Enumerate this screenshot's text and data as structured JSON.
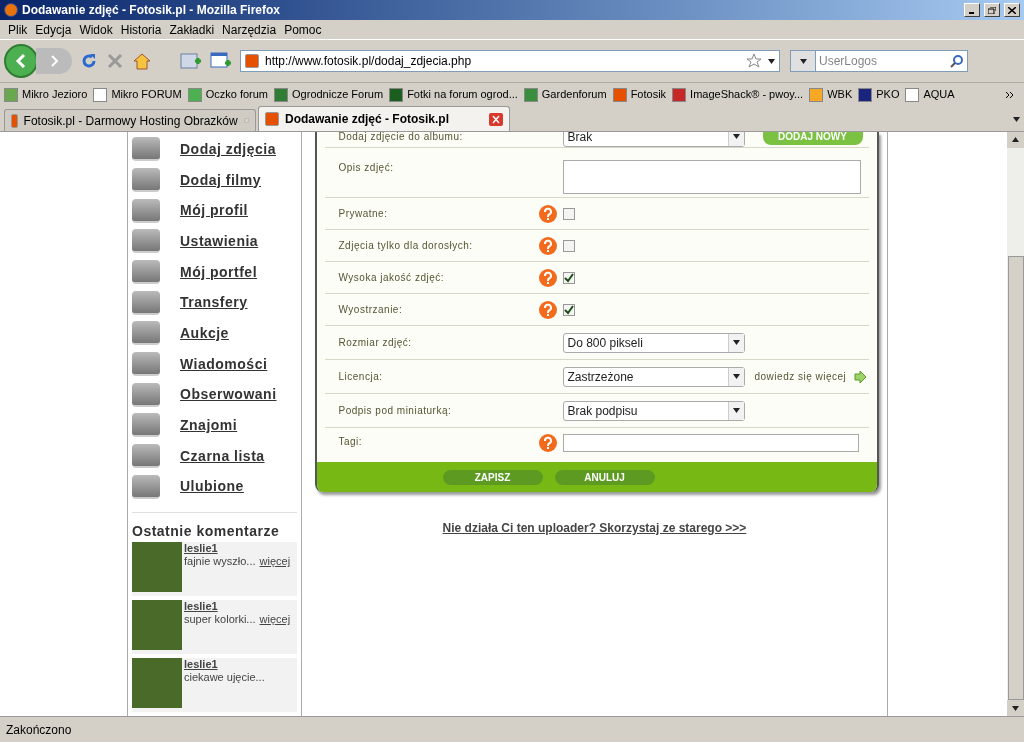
{
  "window": {
    "title": "Dodawanie zdjęć - Fotosik.pl - Mozilla Firefox"
  },
  "menu": [
    "Plik",
    "Edycja",
    "Widok",
    "Historia",
    "Zakładki",
    "Narzędzia",
    "Pomoc"
  ],
  "address": {
    "value": "http://www.fotosik.pl/dodaj_zdjecia.php"
  },
  "search": {
    "placeholder": "UserLogos"
  },
  "bookmarks": [
    {
      "label": "Mikro Jezioro",
      "color": "#6aa84f"
    },
    {
      "label": "Mikro FORUM",
      "color": "#ffffff"
    },
    {
      "label": "Oczko forum",
      "color": "#4caf50"
    },
    {
      "label": "Ogrodnicze  Forum",
      "color": "#2e7d32"
    },
    {
      "label": "Fotki na forum ogrod...",
      "color": "#1b5e20"
    },
    {
      "label": "Gardenforum",
      "color": "#388e3c"
    },
    {
      "label": "Fotosik",
      "color": "#e65100"
    },
    {
      "label": "ImageShack® - pwoy...",
      "color": "#c62828"
    },
    {
      "label": "WBK",
      "color": "#f9a825"
    },
    {
      "label": "PKO",
      "color": "#1a237e"
    },
    {
      "label": "AQUA",
      "color": "#ffffff"
    }
  ],
  "tabs": [
    {
      "label": "Fotosik.pl - Darmowy Hosting Obrazków",
      "selected": false
    },
    {
      "label": "Dodawanie zdjęć - Fotosik.pl",
      "selected": true
    }
  ],
  "sidebar": {
    "items": [
      "Dodaj zdjęcia",
      "Dodaj filmy",
      "Mój profil",
      "Ustawienia",
      "Mój portfel",
      "Transfery",
      "Aukcje",
      "Wiadomości",
      "Obserwowani",
      "Znajomi",
      "Czarna lista",
      "Ulubione"
    ],
    "comments_title": "Ostatnie komentarze",
    "comments": [
      {
        "user": "leslie1",
        "text": "fajnie wyszło...",
        "more": "więcej"
      },
      {
        "user": "leslie1",
        "text": "super kolorki...",
        "more": "więcej"
      },
      {
        "user": "leslie1",
        "text": "ciekawe ujęcie..."
      }
    ]
  },
  "form": {
    "rows": [
      {
        "kind": "select",
        "label": "Dodaj zdjęcie do albumu:",
        "value": "Brak",
        "button": "DODAJ NOWY"
      },
      {
        "kind": "textarea",
        "label": "Opis zdjęć:"
      },
      {
        "kind": "checkbox",
        "label": "Prywatne:",
        "checked": false
      },
      {
        "kind": "checkbox",
        "label": "Zdjęcia tylko dla dorosłych:",
        "checked": false
      },
      {
        "kind": "checkbox",
        "label": "Wysoka jakość zdjęć:",
        "checked": true
      },
      {
        "kind": "checkbox",
        "label": "Wyostrzanie:",
        "checked": true
      },
      {
        "kind": "select",
        "label": "Rozmiar zdjęć:",
        "value": "Do 800 pikseli"
      },
      {
        "kind": "select",
        "label": "Licencja:",
        "value": "Zastrzeżone",
        "link": "dowiedz się więcej"
      },
      {
        "kind": "select",
        "label": "Podpis pod miniaturką:",
        "value": "Brak podpisu"
      },
      {
        "kind": "text",
        "label": "Tagi:"
      }
    ],
    "buttons": [
      "ZAPISZ",
      "ANULUJ"
    ],
    "old_uploader_link": "Nie działa Ci ten uploader? Skorzystaj ze starego >>>"
  },
  "status_bar": "Zakończono"
}
